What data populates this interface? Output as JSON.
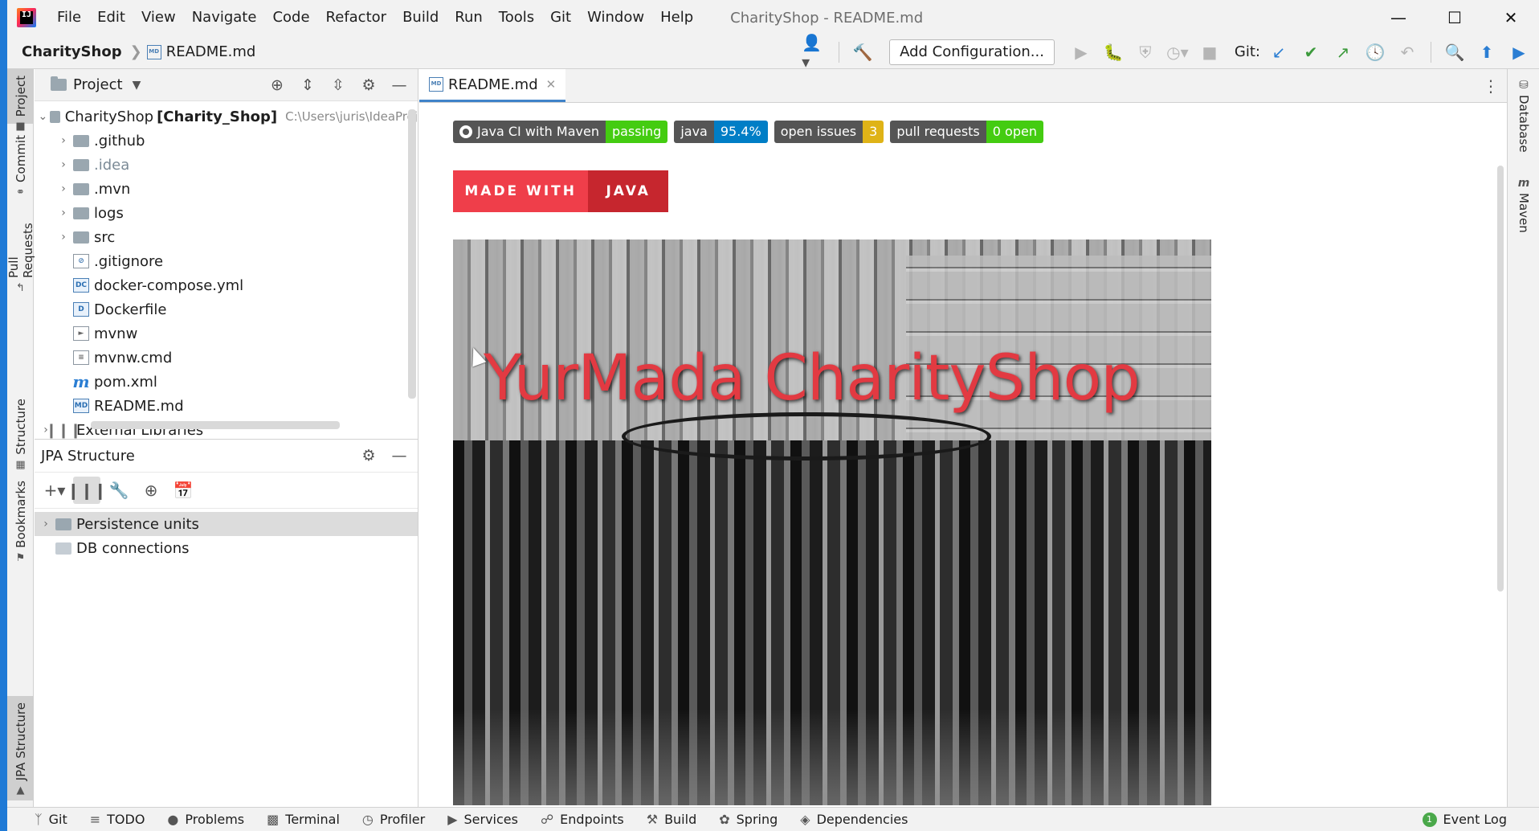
{
  "menu": [
    "File",
    "Edit",
    "View",
    "Navigate",
    "Code",
    "Refactor",
    "Build",
    "Run",
    "Tools",
    "Git",
    "Window",
    "Help"
  ],
  "window_title": "CharityShop - README.md",
  "breadcrumb": {
    "project": "CharityShop",
    "file": "README.md"
  },
  "toolbar": {
    "add_config": "Add Configuration...",
    "git_label": "Git:"
  },
  "left_tabs": {
    "project": "Project",
    "commit": "Commit",
    "pull_requests": "Pull Requests",
    "structure": "Structure",
    "bookmarks": "Bookmarks",
    "jpa_structure": "JPA Structure"
  },
  "right_tabs": {
    "database": "Database",
    "maven": "Maven"
  },
  "project_panel": {
    "title": "Project",
    "root_name": "CharityShop",
    "root_module": "[Charity_Shop]",
    "root_path": "C:\\Users\\juris\\IdeaProj",
    "items": [
      {
        "name": ".github",
        "type": "folder"
      },
      {
        "name": ".idea",
        "type": "folder"
      },
      {
        "name": ".mvn",
        "type": "folder"
      },
      {
        "name": "logs",
        "type": "folder"
      },
      {
        "name": "src",
        "type": "folder"
      },
      {
        "name": ".gitignore",
        "type": "file"
      },
      {
        "name": "docker-compose.yml",
        "type": "file"
      },
      {
        "name": "Dockerfile",
        "type": "file"
      },
      {
        "name": "mvnw",
        "type": "file"
      },
      {
        "name": "mvnw.cmd",
        "type": "file"
      },
      {
        "name": "pom.xml",
        "type": "file"
      },
      {
        "name": "README.md",
        "type": "file"
      }
    ],
    "external_libraries": "External Libraries"
  },
  "jpa_panel": {
    "title": "JPA Structure",
    "items": [
      "Persistence units",
      "DB connections"
    ]
  },
  "editor": {
    "tab_label": "README.md",
    "badges": [
      {
        "label": "Java CI with Maven",
        "value": "passing",
        "color": "#4c1"
      },
      {
        "label": "java",
        "value": "95.4%",
        "color": "#007ec6"
      },
      {
        "label": "open issues",
        "value": "3",
        "color": "#dfb317"
      },
      {
        "label": "pull requests",
        "value": "0 open",
        "color": "#4c1"
      }
    ],
    "made_with": {
      "left": "MADE WITH",
      "right": "JAVA"
    },
    "hero_title": "YurMada CharityShop"
  },
  "statusbar": {
    "items": [
      "Git",
      "TODO",
      "Problems",
      "Terminal",
      "Profiler",
      "Services",
      "Endpoints",
      "Build",
      "Spring",
      "Dependencies"
    ],
    "event_log": "Event Log",
    "event_count": "1"
  }
}
